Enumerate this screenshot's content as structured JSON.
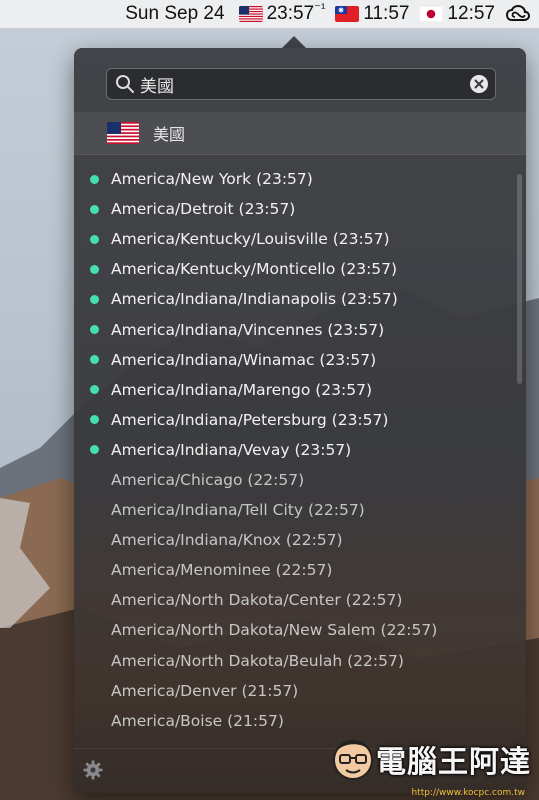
{
  "menubar": {
    "date": "Sun Sep 24",
    "clocks": [
      {
        "flag": "us-flag",
        "time": "23:57",
        "suffix": "⁻¹"
      },
      {
        "flag": "tw-flag",
        "time": "11:57",
        "suffix": ""
      },
      {
        "flag": "jp-flag",
        "time": "12:57",
        "suffix": ""
      }
    ],
    "app_icon": "creative-cloud-icon"
  },
  "popover": {
    "search": {
      "value": "美國",
      "icon": "search-icon",
      "clear_icon": "clear-icon"
    },
    "country": {
      "label": "美國",
      "flag": "us-flag"
    },
    "timezones": [
      {
        "label": "America/New York (23:57)",
        "active": true
      },
      {
        "label": "America/Detroit (23:57)",
        "active": true
      },
      {
        "label": "America/Kentucky/Louisville (23:57)",
        "active": true
      },
      {
        "label": "America/Kentucky/Monticello (23:57)",
        "active": true
      },
      {
        "label": "America/Indiana/Indianapolis (23:57)",
        "active": true
      },
      {
        "label": "America/Indiana/Vincennes (23:57)",
        "active": true
      },
      {
        "label": "America/Indiana/Winamac (23:57)",
        "active": true
      },
      {
        "label": "America/Indiana/Marengo (23:57)",
        "active": true
      },
      {
        "label": "America/Indiana/Petersburg (23:57)",
        "active": true
      },
      {
        "label": "America/Indiana/Vevay (23:57)",
        "active": true
      },
      {
        "label": "America/Chicago (22:57)",
        "active": false
      },
      {
        "label": "America/Indiana/Tell City (22:57)",
        "active": false
      },
      {
        "label": "America/Indiana/Knox (22:57)",
        "active": false
      },
      {
        "label": "America/Menominee (22:57)",
        "active": false
      },
      {
        "label": "America/North Dakota/Center (22:57)",
        "active": false
      },
      {
        "label": "America/North Dakota/New Salem (22:57)",
        "active": false
      },
      {
        "label": "America/North Dakota/Beulah (22:57)",
        "active": false
      },
      {
        "label": "America/Denver (21:57)",
        "active": false
      },
      {
        "label": "America/Boise (21:57)",
        "active": false
      }
    ],
    "footer": {
      "settings_icon": "gear-icon"
    },
    "active_dot_color": "#46e0b0"
  },
  "watermark": {
    "text": "電腦王阿達",
    "url": "http://www.kocpc.com.tw"
  }
}
